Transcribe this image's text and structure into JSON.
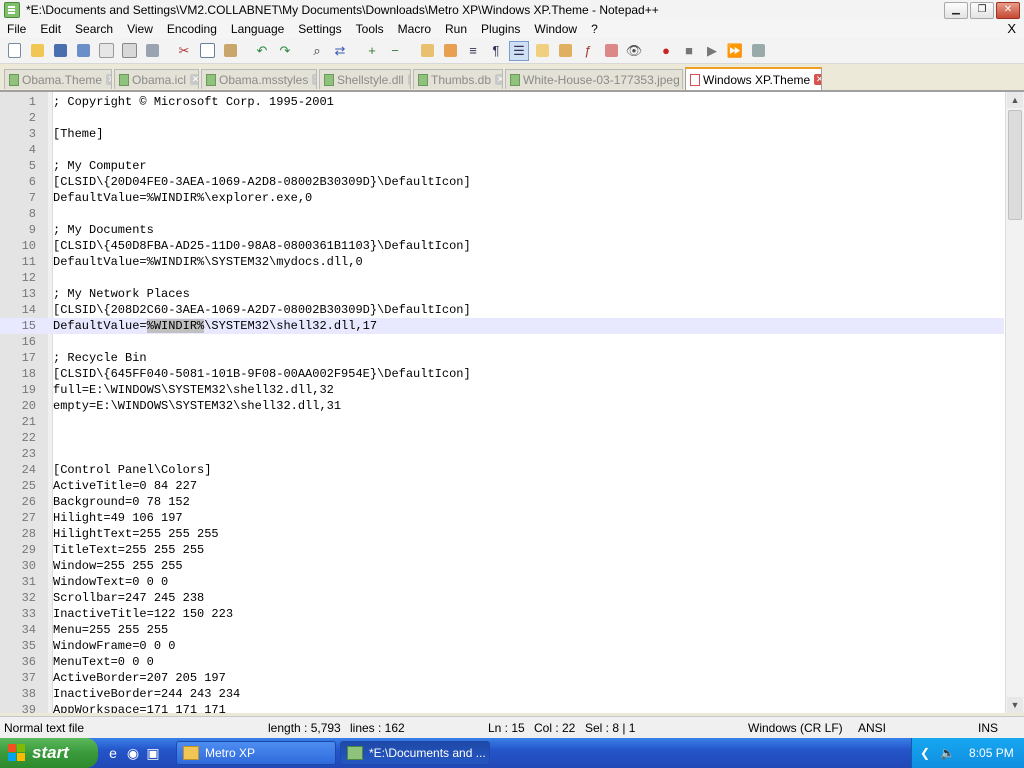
{
  "window": {
    "title": "*E:\\Documents and Settings\\VM2.COLLABNET\\My Documents\\Downloads\\Metro XP\\Windows XP.Theme - Notepad++",
    "min": "▁",
    "max": "❐",
    "close": "✕"
  },
  "menu": {
    "items": [
      "File",
      "Edit",
      "Search",
      "View",
      "Encoding",
      "Language",
      "Settings",
      "Tools",
      "Macro",
      "Run",
      "Plugins",
      "Window",
      "?"
    ],
    "close": "X"
  },
  "tabs": [
    {
      "label": "Obama.Theme"
    },
    {
      "label": "Obama.icl"
    },
    {
      "label": "Obama.msstyles"
    },
    {
      "label": "Shellstyle.dll"
    },
    {
      "label": "Thumbs.db"
    },
    {
      "label": "White-House-03-177353.jpeg"
    },
    {
      "label": "Windows XP.Theme"
    }
  ],
  "tab_close": "✕",
  "editor": {
    "lines": [
      {
        "n": "1",
        "text": "; Copyright © Microsoft Corp. 1995-2001"
      },
      {
        "n": "2",
        "text": ""
      },
      {
        "n": "3",
        "text": "[Theme]"
      },
      {
        "n": "4",
        "text": ""
      },
      {
        "n": "5",
        "text": "; My Computer"
      },
      {
        "n": "6",
        "text": "[CLSID\\{20D04FE0-3AEA-1069-A2D8-08002B30309D}\\DefaultIcon]"
      },
      {
        "n": "7",
        "text": "DefaultValue=%WINDIR%\\explorer.exe,0"
      },
      {
        "n": "8",
        "text": ""
      },
      {
        "n": "9",
        "text": "; My Documents"
      },
      {
        "n": "10",
        "text": "[CLSID\\{450D8FBA-AD25-11D0-98A8-0800361B1103}\\DefaultIcon]"
      },
      {
        "n": "11",
        "text": "DefaultValue=%WINDIR%\\SYSTEM32\\mydocs.dll,0"
      },
      {
        "n": "12",
        "text": ""
      },
      {
        "n": "13",
        "text": "; My Network Places"
      },
      {
        "n": "14",
        "text": "[CLSID\\{208D2C60-3AEA-1069-A2D7-08002B30309D}\\DefaultIcon]"
      },
      {
        "n": "15",
        "pre": "DefaultValue=",
        "sel": "%WINDIR%",
        "post": "\\SYSTEM32\\shell32.dll,17",
        "current": true
      },
      {
        "n": "16",
        "text": ""
      },
      {
        "n": "17",
        "text": "; Recycle Bin"
      },
      {
        "n": "18",
        "text": "[CLSID\\{645FF040-5081-101B-9F08-00AA002F954E}\\DefaultIcon]"
      },
      {
        "n": "19",
        "text": "full=E:\\WINDOWS\\SYSTEM32\\shell32.dll,32"
      },
      {
        "n": "20",
        "text": "empty=E:\\WINDOWS\\SYSTEM32\\shell32.dll,31"
      },
      {
        "n": "21",
        "text": ""
      },
      {
        "n": "22",
        "text": ""
      },
      {
        "n": "23",
        "text": ""
      },
      {
        "n": "24",
        "text": "[Control Panel\\Colors]"
      },
      {
        "n": "25",
        "text": "ActiveTitle=0 84 227"
      },
      {
        "n": "26",
        "text": "Background=0 78 152"
      },
      {
        "n": "27",
        "text": "Hilight=49 106 197"
      },
      {
        "n": "28",
        "text": "HilightText=255 255 255"
      },
      {
        "n": "29",
        "text": "TitleText=255 255 255"
      },
      {
        "n": "30",
        "text": "Window=255 255 255"
      },
      {
        "n": "31",
        "text": "WindowText=0 0 0"
      },
      {
        "n": "32",
        "text": "Scrollbar=247 245 238"
      },
      {
        "n": "33",
        "text": "InactiveTitle=122 150 223"
      },
      {
        "n": "34",
        "text": "Menu=255 255 255"
      },
      {
        "n": "35",
        "text": "WindowFrame=0 0 0"
      },
      {
        "n": "36",
        "text": "MenuText=0 0 0"
      },
      {
        "n": "37",
        "text": "ActiveBorder=207 205 197"
      },
      {
        "n": "38",
        "text": "InactiveBorder=244 243 234"
      },
      {
        "n": "39",
        "text": "AppWorkspace=171 171 171"
      }
    ]
  },
  "status": {
    "filetype": "Normal text file",
    "length": "length : 5,793",
    "lines": "lines : 162",
    "ln": "Ln : 15",
    "col": "Col : 22",
    "sel": "Sel : 8 | 1",
    "eol": "Windows (CR LF)",
    "encoding": "ANSI",
    "mode": "INS"
  },
  "taskbar": {
    "start": "start",
    "tasks": [
      {
        "label": "Metro XP"
      },
      {
        "label": "*E:\\Documents and ..."
      }
    ],
    "clock": "8:05 PM"
  },
  "colors": {
    "accent_tab": "#f0a020",
    "current_line": "#e8e8ff",
    "taskbar": "#2455c9",
    "start": "#3a9a3a"
  }
}
